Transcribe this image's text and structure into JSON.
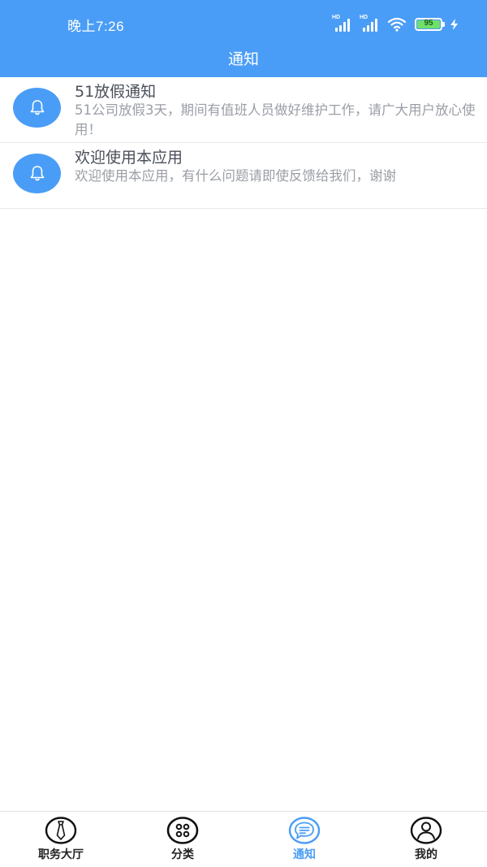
{
  "status_bar": {
    "time": "晚上7:26",
    "signal_label_1": "HD",
    "signal_label_2": "HD",
    "battery": "95"
  },
  "header": {
    "title": "通知"
  },
  "notifications": [
    {
      "icon": "bell-icon",
      "title": "51放假通知",
      "body": "51公司放假3天，期间有值班人员做好维护工作，请广大用户放心使用！"
    },
    {
      "icon": "bell-icon",
      "title": "欢迎使用本应用",
      "body": "欢迎使用本应用，有什么问题请即使反馈给我们，谢谢"
    }
  ],
  "tabbar": {
    "tabs": [
      {
        "label": "职务大厅",
        "icon": "tie-icon",
        "active": false
      },
      {
        "label": "分类",
        "icon": "grid-icon",
        "active": false
      },
      {
        "label": "通知",
        "icon": "chat-icon",
        "active": true
      },
      {
        "label": "我的",
        "icon": "user-icon",
        "active": false
      }
    ],
    "accent": "#4a9df6"
  },
  "colors": {
    "primary": "#4a9df6"
  }
}
